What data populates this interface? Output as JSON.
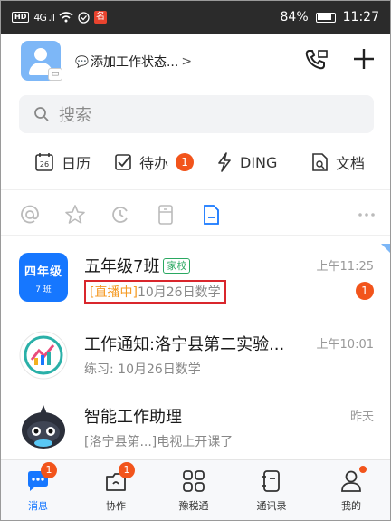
{
  "statusbar": {
    "hd": "HD",
    "signal": "4G .ıl",
    "battery": "84%",
    "time": "11:27"
  },
  "header": {
    "work_status": "添加工作状态...",
    "chevron": ">"
  },
  "search": {
    "placeholder": "搜索"
  },
  "quick_nav": [
    {
      "label": "日历",
      "icon": "calendar-icon",
      "num": "26"
    },
    {
      "label": "待办",
      "icon": "checkbox-icon",
      "badge": "1"
    },
    {
      "label": "DING",
      "icon": "lightning-icon"
    },
    {
      "label": "文档",
      "icon": "document-icon"
    }
  ],
  "filters": [
    "at-icon",
    "star-icon",
    "clock-icon",
    "archive-icon",
    "file-icon",
    "more-icon"
  ],
  "conversations": [
    {
      "icon_line1": "四年级",
      "icon_line2": "7 班",
      "title": "五年级7班",
      "tag": "家校",
      "live": "[直播中]",
      "sub": "10月26日数学",
      "time": "上午11:25",
      "unread": "1"
    },
    {
      "title": "工作通知:洛宁县第二实验...",
      "sub": "练习: 10月26日数学",
      "time": "上午10:01"
    },
    {
      "title": "智能工作助理",
      "sub": "[洛宁县第...]电视上开课了",
      "time": "昨天"
    }
  ],
  "tabs": [
    {
      "label": "消息",
      "badge": "1",
      "icon": "message-icon",
      "active": true
    },
    {
      "label": "协作",
      "badge": "1",
      "icon": "collab-icon"
    },
    {
      "label": "豫税通",
      "icon": "apps-grid-icon"
    },
    {
      "label": "通讯录",
      "icon": "contacts-icon"
    },
    {
      "label": "我的",
      "icon": "profile-icon"
    }
  ],
  "colors": {
    "accent": "#1677ff",
    "badge": "#f2541b",
    "live": "#f59a23",
    "highlight": "#d9262c"
  }
}
